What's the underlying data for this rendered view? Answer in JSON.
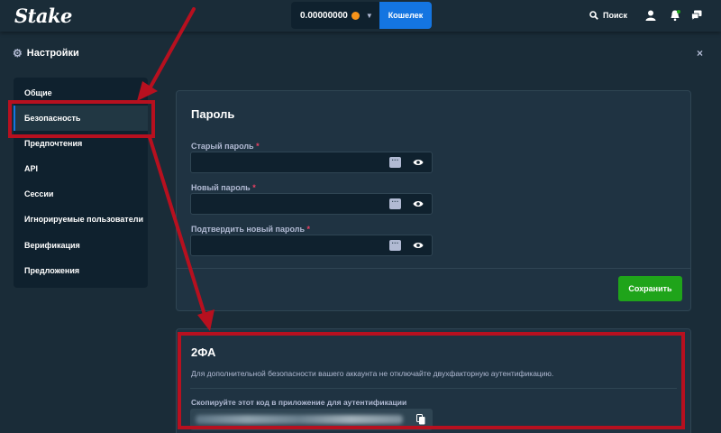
{
  "header": {
    "logo": "Stake",
    "balance": "0.00000000",
    "wallet_label": "Кошелек",
    "search_label": "Поиск",
    "icons": [
      "user-icon",
      "notification-icon",
      "chat-icon"
    ]
  },
  "settings": {
    "title": "Настройки",
    "close": "×"
  },
  "sidebar": {
    "items": [
      {
        "label": "Общие",
        "active": false
      },
      {
        "label": "Безопасность",
        "active": true
      },
      {
        "label": "Предпочтения",
        "active": false
      },
      {
        "label": "API",
        "active": false
      },
      {
        "label": "Сессии",
        "active": false
      },
      {
        "label": "Игнорируемые пользователи",
        "active": false
      },
      {
        "label": "Верификация",
        "active": false
      },
      {
        "label": "Предложения",
        "active": false
      }
    ]
  },
  "password": {
    "title": "Пароль",
    "old_label": "Старый пароль",
    "new_label": "Новый пароль",
    "confirm_label": "Подтвердить новый пароль",
    "required_mark": "*",
    "save_label": "Сохранить"
  },
  "twofa": {
    "title": "2ФА",
    "description": "Для дополнительной безопасности вашего аккаунта не отключайте двухфакторную аутентификацию.",
    "code_label": "Скопируйте этот код в приложение для аутентификации"
  },
  "colors": {
    "background": "#1a2c38",
    "panel": "#1f3342",
    "accent_blue": "#1475e1",
    "save_green": "#1fa41a",
    "annotation_red": "#b7101f"
  }
}
